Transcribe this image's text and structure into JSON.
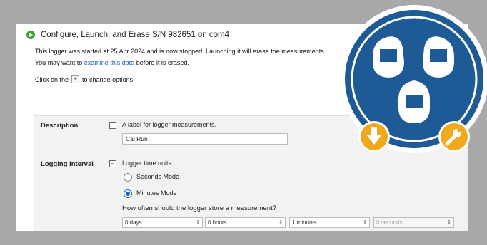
{
  "window": {
    "title": "Configure, Launch, and Erase S/N 982651 on com4",
    "message_line1": "This logger was started at 25 Apr 2024 and is now stopped. Launching it will erase the measurements.",
    "message_line2_prefix": "You may want to",
    "message_line2_link": "examine this data",
    "message_line2_suffix": "before it is erased.",
    "hint_prefix": "Click on the",
    "hint_suffix": "to change options"
  },
  "description": {
    "label": "Description",
    "subtext": "A label for logger measurements.",
    "value": "Cal Run"
  },
  "logging_interval": {
    "label": "Logging Interval",
    "subtext": "Logger time units:",
    "seconds_mode": "Seconds Mode",
    "minutes_mode": "Minutes Mode",
    "selected": "minutes",
    "question": "How often should the logger store a measurement?",
    "spin_days": "0 days",
    "spin_hours": "0 hours",
    "spin_minutes": "1 minutes",
    "spin_seconds": "0 seconds"
  },
  "colors": {
    "badge_blue": "#1d5a96",
    "badge_orange": "#f2a81d",
    "radio_selected": "#1f5fbf",
    "link": "#1a5fb4"
  },
  "icons": {
    "app": "launch-icon",
    "badge": "loggers-badge-icon",
    "download": "download-arrow-icon",
    "wrench": "wrench-icon"
  }
}
